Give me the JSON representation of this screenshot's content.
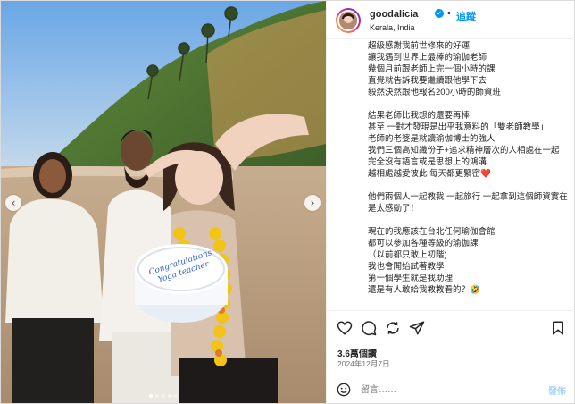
{
  "post": {
    "username": "goodalicia",
    "separator": "•",
    "follow_label": "追蹤",
    "location": "Kerala, India",
    "caption_lines": [
      "超級感謝我前世修來的好運",
      "讓我遇到世界上最棒的瑜伽老師",
      "幾個月前跟老師上完一個小時的課",
      "直覺就告訴我要繼續跟他學下去",
      "毅然決然跟他報名200小時的師資班",
      "",
      "結果老師比我想的還要再棒",
      "甚至 一對才發現是出乎我意料的「雙老師教學」",
      "老師的老婆是就讀瑜伽博士的強人",
      "我們三個高知識份子+追求精神層次的人相處在一起",
      "完全沒有語言或是思想上的鴻溝",
      "越相處越愛彼此 每天都更緊密❤️",
      "",
      "他們兩個人一起教我 一起旅行 一起拿到這個師資實在是太感動了！",
      "",
      "現在的我應該在台北任何瑜伽會館",
      "都可以參加各種等級的瑜伽課",
      "（以前都只敢上初階)",
      "我也會開始試著教學",
      "第一個學生就是我助理",
      "還是有人敢給我教教看的？🤣"
    ],
    "likes": "3.6萬個讚",
    "date": "2024年12月7日"
  },
  "comment": {
    "placeholder": "留言……",
    "post_label": "發佈"
  },
  "photo": {
    "cake_text_line1": "Congratulations",
    "cake_text_line2": "Yoga teacher"
  },
  "icons": {
    "like": "heart-icon",
    "comment": "comment-icon",
    "share": "share-icon",
    "send": "send-icon",
    "save": "bookmark-icon",
    "emoji": "emoji-icon",
    "verified": "verified-icon",
    "prev": "chevron-left-icon",
    "next": "chevron-right-icon"
  },
  "colors": {
    "accent": "#0095f6",
    "text": "#262626",
    "muted": "#737373"
  }
}
